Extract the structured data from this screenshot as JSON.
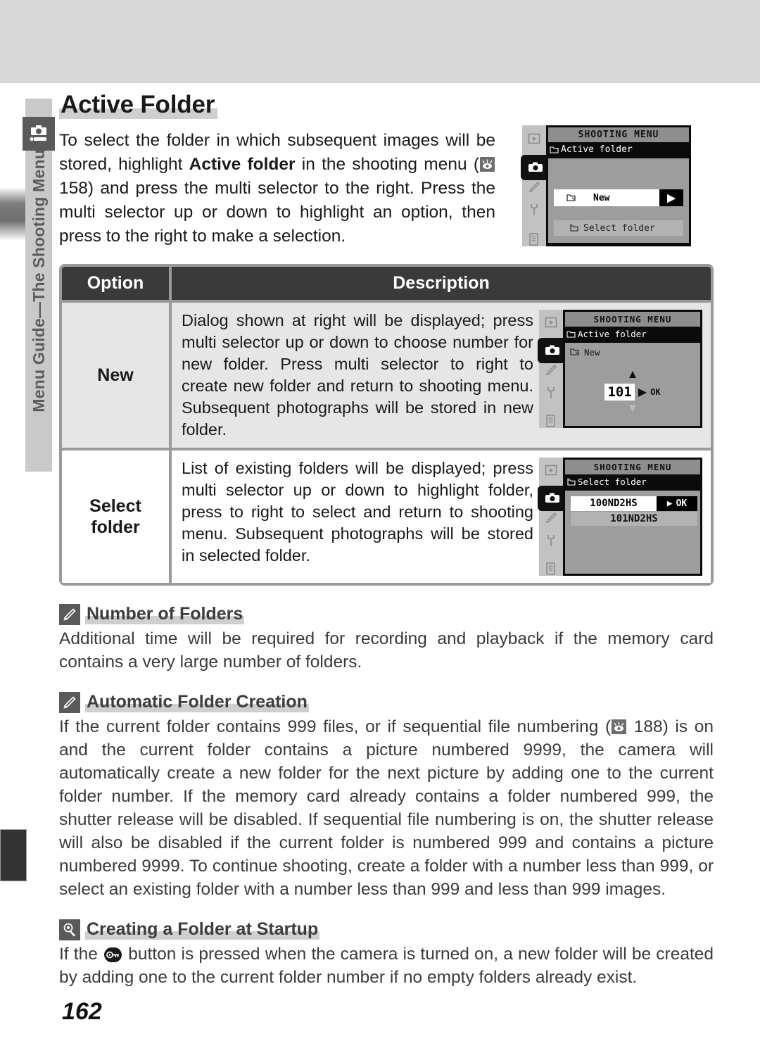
{
  "sidebar": {
    "vertical_label": "Menu Guide—The Shooting Menu",
    "camera_icon": "camera-icon"
  },
  "page": {
    "title": "Active Folder",
    "number": "162"
  },
  "intro": {
    "part1": "To select the folder in which subsequent images will be stored, highlight ",
    "bold": "Active folder",
    "part2": " in the shooting menu (",
    "ref_icon": "eye-reference-icon",
    "ref_page": " 158) and press the multi selector to the right.  Press the multi selector up or down to highlight an option, then press to the right to make a selection."
  },
  "lcd_top": {
    "title": "SHOOTING MENU",
    "subtitle": "Active folder",
    "subtitle_icon": "folder-icon",
    "selected_row": {
      "label": "New",
      "icon": "new-folder-icon",
      "arrow": "▶"
    },
    "second_row": {
      "label": "Select folder",
      "icon": "folders-icon"
    },
    "side_tabs": [
      "playback-icon",
      "camera-icon",
      "pencil-icon",
      "wrench-icon",
      "pages-icon"
    ]
  },
  "table": {
    "headers": {
      "option": "Option",
      "description": "Description"
    },
    "rows": [
      {
        "option": "New",
        "description": "Dialog shown at right will be displayed; press multi selector up or down to choose number for new folder.  Press multi selector to right to create new folder and return to shooting menu.  Subsequent photographs will be stored in new folder.",
        "lcd": {
          "title": "SHOOTING MENU",
          "subtitle": "Active folder",
          "subtitle_icon": "folder-icon",
          "item_label": "New",
          "item_icon": "new-folder-icon",
          "up_arrow": "▲",
          "value": "101",
          "right_arrow": "▶",
          "ok": "OK",
          "down_arrow": "▼",
          "side_tabs": [
            "playback-icon",
            "camera-icon",
            "pencil-icon",
            "wrench-icon",
            "pages-icon"
          ]
        }
      },
      {
        "option": "Select folder",
        "description": "List of existing folders will be displayed; press multi selector up or down to highlight folder, press to right to select and return to shooting menu.  Subsequent photographs will be stored in selected folder.",
        "lcd": {
          "title": "SHOOTING MENU",
          "subtitle": "Select folder",
          "subtitle_icon": "folders-icon",
          "selected_item": "100ND2HS",
          "right_arrow": "▶",
          "ok": "OK",
          "second_item": "101ND2HS",
          "side_tabs": [
            "playback-icon",
            "camera-icon",
            "pencil-icon",
            "wrench-icon",
            "pages-icon"
          ]
        }
      }
    ]
  },
  "notes": [
    {
      "icon": "pencil-note-icon",
      "title": "Number of Folders",
      "body": "Additional time will be required for recording and playback if the memory card contains a very large number of folders."
    },
    {
      "icon": "pencil-note-icon",
      "title": "Automatic Folder Creation",
      "body_part1": "If the current folder contains 999 files, or if sequential file numbering (",
      "ref_icon": "eye-reference-icon",
      "body_part2": " 188) is on and the current folder contains a picture numbered 9999, the camera will automatically create a new folder for the next picture by adding one to the current folder number.  If the memory card already contains a folder numbered 999, the shutter release will be disabled.  If sequential file numbering is on, the shutter release will also be disabled if the current folder is numbered 999 and contains a picture numbered 9999.   To continue shooting, create a folder with a number less than 999, or select an existing folder with a number less than 999 and less than 999 images."
    },
    {
      "icon": "tip-magnifier-icon",
      "title": "Creating a Folder at Startup",
      "body_part1": "If the ",
      "button_icon": "key-button-icon",
      "body_part2": " button is pressed when the camera is turned on, a new folder will be created by adding one to the current folder number if no empty folders already exist."
    }
  ]
}
